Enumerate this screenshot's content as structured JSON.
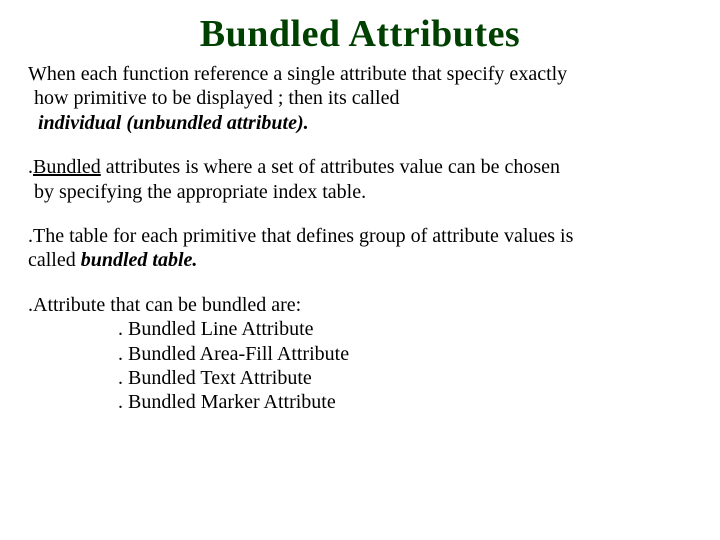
{
  "slide": {
    "title": "Bundled Attributes",
    "p1_l1": "When each function reference a single attribute that specify exactly",
    "p1_l2": "how primitive to be displayed ; then its called",
    "p1_l3": "individual (unbundled attribute).",
    "p2_lead": ".",
    "p2_b": "Bundled",
    "p2_l1_rest": " attributes is where a set of attributes value can be chosen",
    "p2_l2": "by specifying the   appropriate index table.",
    "p3_l1": ".The table for each primitive that defines group of attribute values is",
    "p3_l2a": "called ",
    "p3_l2b": "bundled table.",
    "p4_intro": ".Attribute that can be bundled are:",
    "p4_items": [
      ". Bundled Line Attribute",
      ". Bundled Area-Fill Attribute",
      ". Bundled Text Attribute",
      ". Bundled Marker Attribute"
    ]
  }
}
